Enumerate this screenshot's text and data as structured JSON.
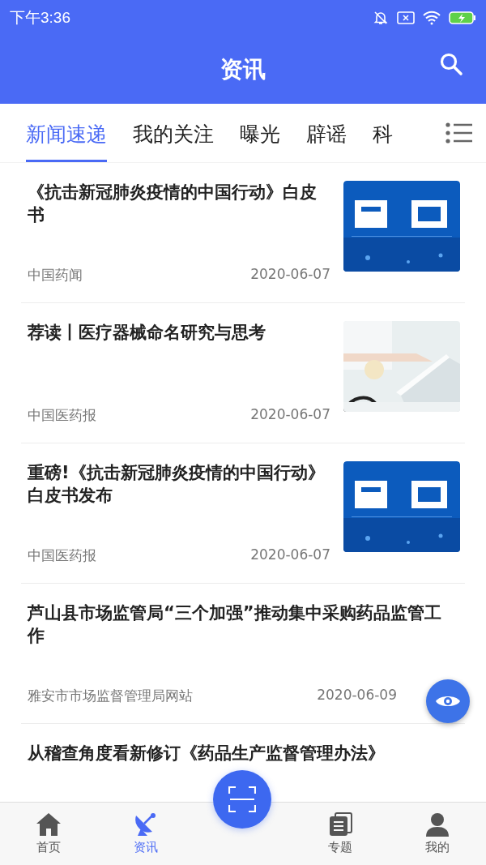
{
  "status_bar": {
    "time": "下午3:36"
  },
  "header": {
    "title": "资讯"
  },
  "tabs": [
    {
      "label": "新闻速递",
      "selected": true
    },
    {
      "label": "我的关注",
      "selected": false
    },
    {
      "label": "曝光",
      "selected": false
    },
    {
      "label": "辟谣",
      "selected": false
    },
    {
      "label": "科",
      "selected": false
    }
  ],
  "articles": [
    {
      "title": "《抗击新冠肺炎疫情的中国行动》白皮书",
      "source": "中国药闻",
      "date": "2020-06-07",
      "kind": "picture"
    },
    {
      "title": "荐读丨医疗器械命名研究与思考",
      "source": "中国医药报",
      "date": "2020-06-07",
      "kind": "picture"
    },
    {
      "title": "重磅!《抗击新冠肺炎疫情的中国行动》白皮书发布",
      "source": "中国医药报",
      "date": "2020-06-07",
      "kind": "picture"
    },
    {
      "title": "芦山县市场监管局“三个加强”推动集中采购药品监管工作",
      "source": "雅安市市场监督管理局网站",
      "date": "2020-06-09"
    },
    {
      "title": "从稽查角度看新修订《药品生产监督管理办法》"
    }
  ],
  "bottom_nav": [
    {
      "label": "首页",
      "kind": "home",
      "selected": false
    },
    {
      "label": "资讯",
      "kind": "dish",
      "selected": true
    },
    {
      "label": "专题",
      "kind": "docs",
      "selected": false
    },
    {
      "label": "我的",
      "kind": "user",
      "selected": false
    }
  ]
}
